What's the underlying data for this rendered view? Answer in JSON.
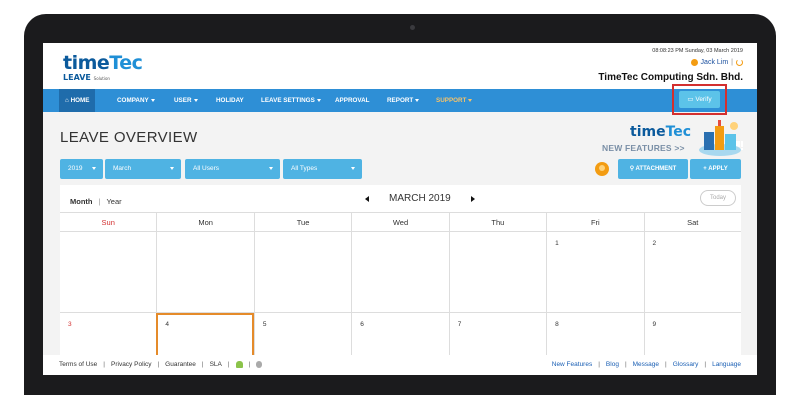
{
  "header": {
    "logo": {
      "main_a": "time",
      "main_b": "Tec",
      "sub": "LEAVE",
      "sub_small": "Solution"
    },
    "datetime": "08:08:23 PM Sunday, 03 March 2019",
    "user_name": "Jack Lim",
    "company": "TimeTec Computing Sdn. Bhd."
  },
  "nav": {
    "items": [
      {
        "label": "HOME",
        "icon": "home-icon"
      },
      {
        "label": "COMPANY"
      },
      {
        "label": "USER"
      },
      {
        "label": "HOLIDAY"
      },
      {
        "label": "LEAVE SETTINGS"
      },
      {
        "label": "APPROVAL"
      },
      {
        "label": "REPORT"
      },
      {
        "label": "SUPPORT"
      }
    ],
    "verify_label": "Verify",
    "highlight_color": "#d32f2f"
  },
  "page": {
    "title": "LEAVE OVERVIEW",
    "banner": {
      "logo_a": "time",
      "logo_b": "Tec",
      "text": "NEW FEATURES >>"
    }
  },
  "filters": {
    "year": "2019",
    "month": "March",
    "users": "All Users",
    "types": "All Types"
  },
  "actions": {
    "attachment": "ATTACHMENT",
    "apply": "APPLY"
  },
  "calendar": {
    "view_month": "Month",
    "view_year": "Year",
    "title": "MARCH 2019",
    "today_label": "Today",
    "weekdays": [
      "Sun",
      "Mon",
      "Tue",
      "Wed",
      "Thu",
      "Fri",
      "Sat"
    ],
    "week1": [
      "",
      "",
      "",
      "",
      "",
      "1",
      "2"
    ],
    "week2": [
      "3",
      "4",
      "5",
      "6",
      "7",
      "8",
      "9"
    ]
  },
  "footer": {
    "left": [
      "Terms of Use",
      "Privacy Policy",
      "Guarantee",
      "SLA"
    ],
    "right": [
      "New Features",
      "Blog",
      "Message",
      "Glossary",
      "Language"
    ]
  },
  "colors": {
    "nav": "#2e8fd6",
    "button": "#4fb3e3",
    "accent": "#f39c12"
  }
}
